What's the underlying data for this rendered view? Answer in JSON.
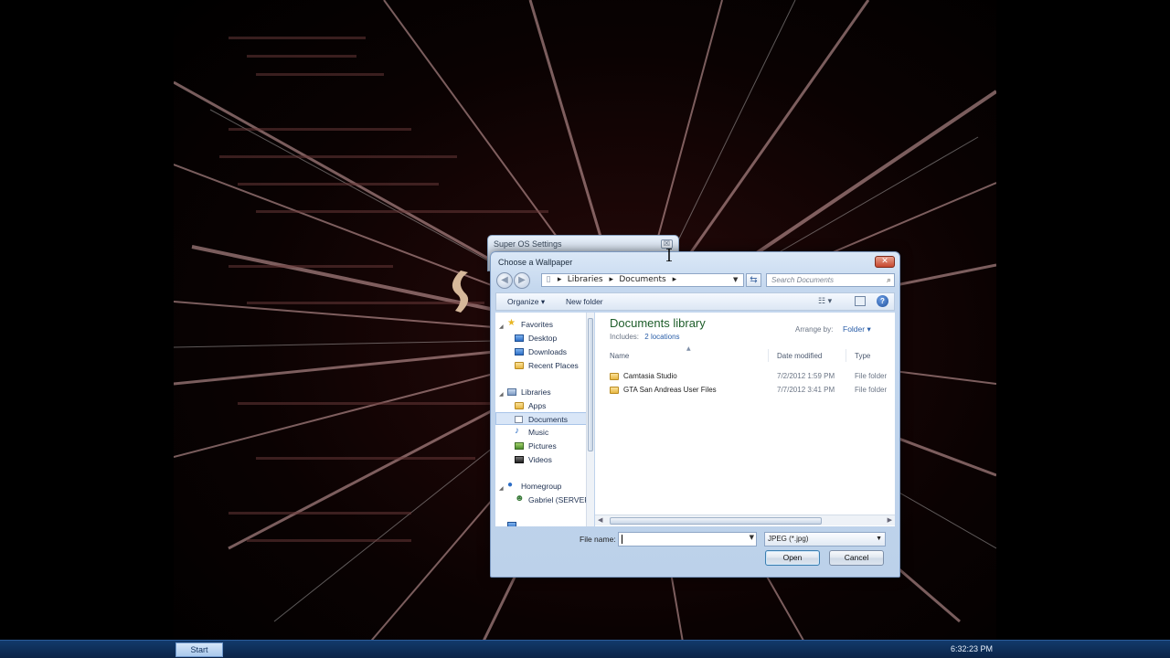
{
  "taskbar": {
    "start_label": "Start",
    "clock": "6:32:23 PM"
  },
  "settings_window": {
    "title": "Super OS Settings",
    "close_glyph": "☒"
  },
  "dialog": {
    "title": "Choose a Wallpaper",
    "close_glyph": "✕",
    "breadcrumb": [
      "Libraries",
      "Documents"
    ],
    "search_placeholder": "Search Documents",
    "commands": {
      "organize": "Organize ▾",
      "new_folder": "New folder",
      "views_glyph": "☷ ▾",
      "help_glyph": "?"
    },
    "nav": {
      "favorites": "Favorites",
      "desktop": "Desktop",
      "downloads": "Downloads",
      "recent": "Recent Places",
      "libraries": "Libraries",
      "apps": "Apps",
      "documents": "Documents",
      "music": "Music",
      "pictures": "Pictures",
      "videos": "Videos",
      "homegroup": "Homegroup",
      "user": "Gabriel (SERVER-"
    },
    "library": {
      "title": "Documents library",
      "includes_label": "Includes:",
      "locations": "2 locations",
      "arrange_label": "Arrange by:",
      "arrange_value": "Folder ▾"
    },
    "columns": {
      "name": "Name",
      "date": "Date modified",
      "type": "Type"
    },
    "files": [
      {
        "name": "Camtasia Studio",
        "date": "7/2/2012 1:59 PM",
        "type": "File folder"
      },
      {
        "name": "GTA San Andreas User Files",
        "date": "7/7/2012 3:41 PM",
        "type": "File folder"
      }
    ],
    "filename_label": "File name:",
    "filename_value": "",
    "filetype": "JPEG (*.jpg)",
    "open_label": "Open",
    "cancel_label": "Cancel"
  }
}
